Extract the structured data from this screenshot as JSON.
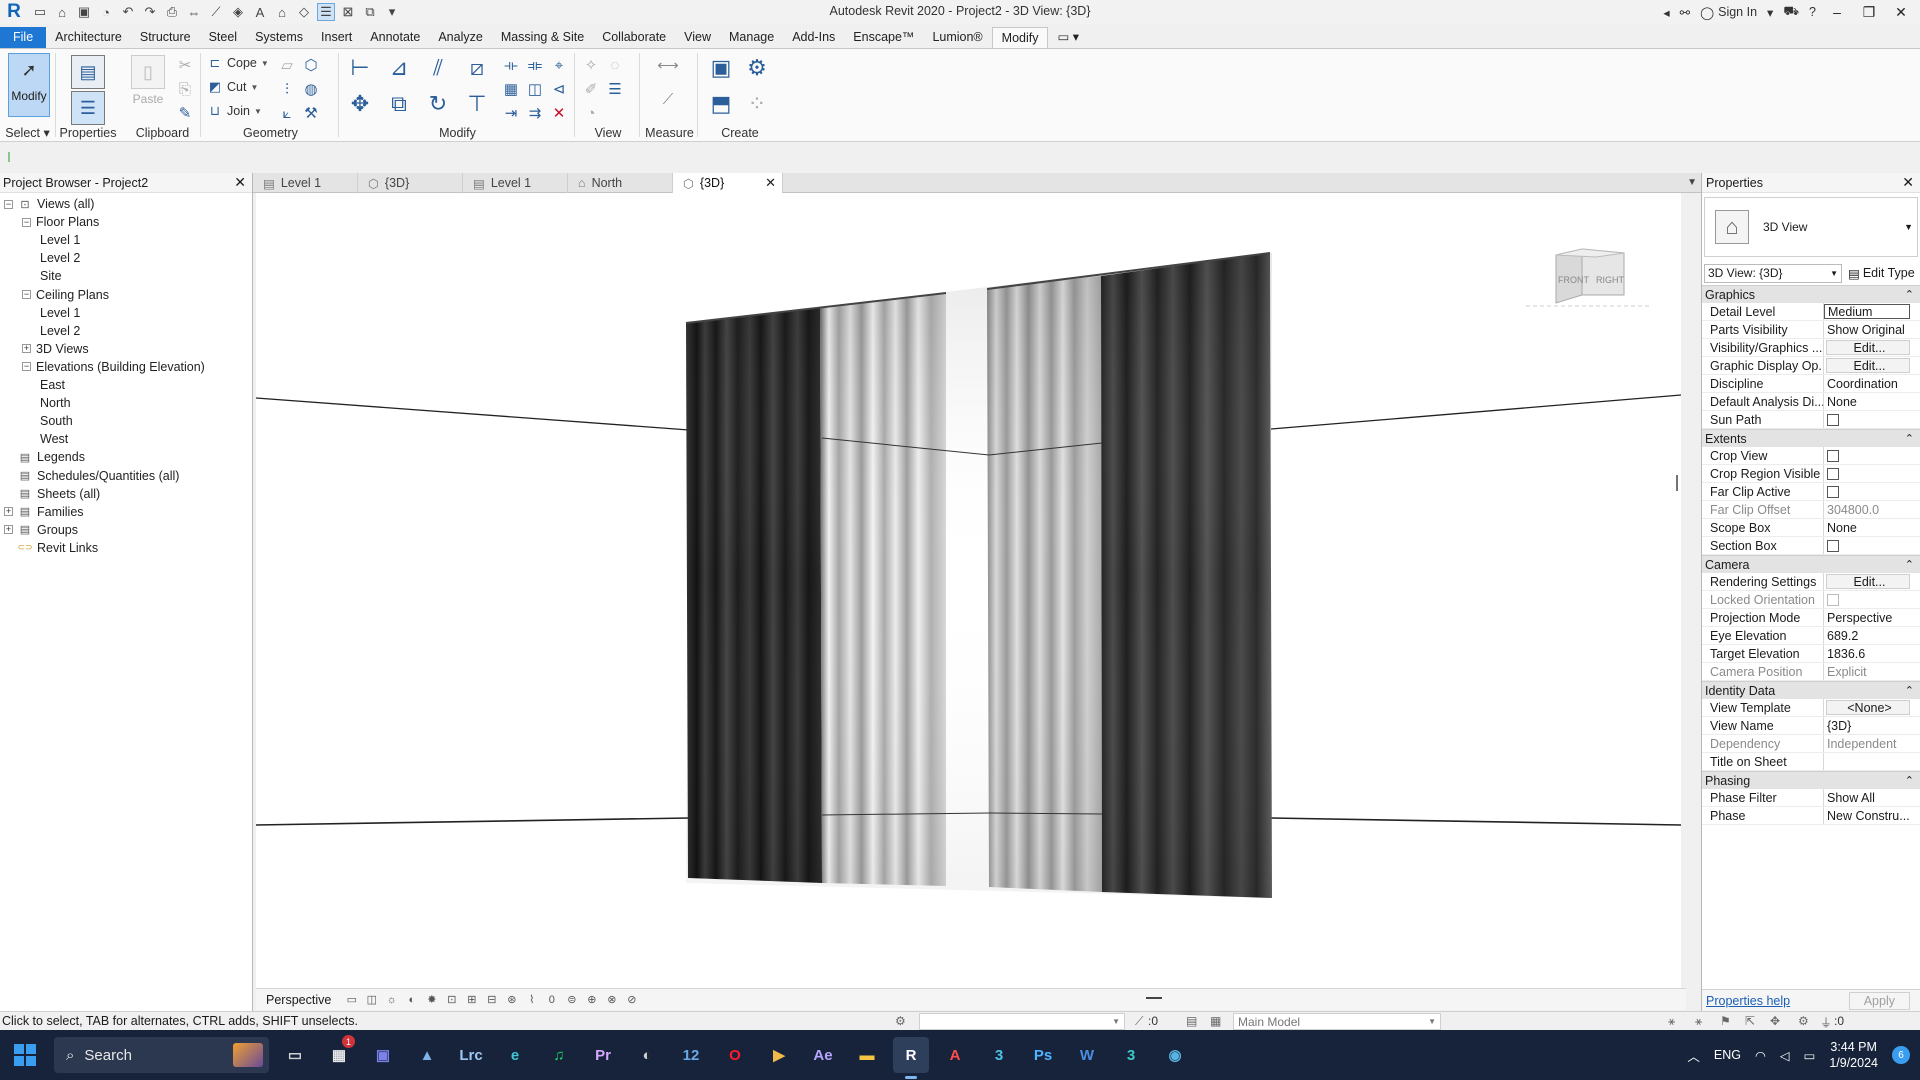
{
  "app": {
    "title": "Autodesk Revit 2020 - Project2 - 3D View: {3D}",
    "sign_in": "Sign In"
  },
  "ribbon": {
    "tabs": [
      "File",
      "Architecture",
      "Structure",
      "Steel",
      "Systems",
      "Insert",
      "Annotate",
      "Analyze",
      "Massing & Site",
      "Collaborate",
      "View",
      "Manage",
      "Add-Ins",
      "Enscape™",
      "Lumion®",
      "Modify"
    ],
    "active_tab": "Modify",
    "select_panel": {
      "modify_label": "Modify",
      "label": "Select"
    },
    "properties_button": "Properties",
    "clipboard": {
      "paste": "Paste",
      "label": "Clipboard"
    },
    "geometry": {
      "cope": "Cope",
      "cut": "Cut",
      "join": "Join",
      "label": "Geometry"
    },
    "modify_label": "Modify",
    "view_label": "View",
    "measure_label": "Measure",
    "create_label": "Create"
  },
  "project_browser": {
    "title": "Project Browser - Project2",
    "items": [
      {
        "label": "Views (all)",
        "level": 0,
        "toggle": "−",
        "icon": "views-icon"
      },
      {
        "label": "Floor Plans",
        "level": 1,
        "toggle": "−"
      },
      {
        "label": "Level 1",
        "level": 2
      },
      {
        "label": "Level 2",
        "level": 2
      },
      {
        "label": "Site",
        "level": 2
      },
      {
        "label": "Ceiling Plans",
        "level": 1,
        "toggle": "−"
      },
      {
        "label": "Level 1",
        "level": 2
      },
      {
        "label": "Level 2",
        "level": 2
      },
      {
        "label": "3D Views",
        "level": 1,
        "toggle": "+"
      },
      {
        "label": "Elevations (Building Elevation)",
        "level": 1,
        "toggle": "−"
      },
      {
        "label": "East",
        "level": 2
      },
      {
        "label": "North",
        "level": 2
      },
      {
        "label": "South",
        "level": 2
      },
      {
        "label": "West",
        "level": 2
      },
      {
        "label": "Legends",
        "level": 0,
        "icon": "legend-icon"
      },
      {
        "label": "Schedules/Quantities (all)",
        "level": 0,
        "icon": "schedule-icon"
      },
      {
        "label": "Sheets (all)",
        "level": 0,
        "icon": "sheet-icon"
      },
      {
        "label": "Families",
        "level": 0,
        "toggle": "+",
        "icon": "families-icon"
      },
      {
        "label": "Groups",
        "level": 0,
        "toggle": "+",
        "icon": "groups-icon"
      },
      {
        "label": "Revit Links",
        "level": 0,
        "icon": "link-icon"
      }
    ]
  },
  "view_tabs": [
    {
      "label": "Level 1",
      "icon": "floor-plan-icon"
    },
    {
      "label": "{3D}",
      "icon": "3d-view-icon"
    },
    {
      "label": "Level 1",
      "icon": "floor-plan-icon"
    },
    {
      "label": "North",
      "icon": "elevation-icon"
    },
    {
      "label": "{3D}",
      "icon": "3d-view-icon",
      "active": true
    }
  ],
  "view_cube": {
    "front": "FRONT",
    "right": "RIGHT"
  },
  "view_control": {
    "mode": "Perspective",
    "zero": "0"
  },
  "properties": {
    "title": "Properties",
    "type_name": "3D View",
    "instance_selector": "3D View: {3D}",
    "edit_type": "Edit Type",
    "groups": [
      {
        "name": "Graphics",
        "rows": [
          {
            "k": "Detail Level",
            "v": "Medium",
            "kind": "boxed"
          },
          {
            "k": "Parts Visibility",
            "v": "Show Original"
          },
          {
            "k": "Visibility/Graphics ...",
            "v": "Edit...",
            "kind": "btn"
          },
          {
            "k": "Graphic Display Op...",
            "v": "Edit...",
            "kind": "btn"
          },
          {
            "k": "Discipline",
            "v": "Coordination"
          },
          {
            "k": "Default Analysis Di...",
            "v": "None"
          },
          {
            "k": "Sun Path",
            "v": "",
            "kind": "check"
          }
        ]
      },
      {
        "name": "Extents",
        "rows": [
          {
            "k": "Crop View",
            "v": "",
            "kind": "check"
          },
          {
            "k": "Crop Region Visible",
            "v": "",
            "kind": "check"
          },
          {
            "k": "Far Clip Active",
            "v": "",
            "kind": "check"
          },
          {
            "k": "Far Clip Offset",
            "v": "304800.0",
            "kind": "dim"
          },
          {
            "k": "Scope Box",
            "v": "None"
          },
          {
            "k": "Section Box",
            "v": "",
            "kind": "check"
          }
        ]
      },
      {
        "name": "Camera",
        "rows": [
          {
            "k": "Rendering Settings",
            "v": "Edit...",
            "kind": "btn"
          },
          {
            "k": "Locked Orientation",
            "v": "",
            "kind": "dimcheck"
          },
          {
            "k": "Projection Mode",
            "v": "Perspective"
          },
          {
            "k": "Eye Elevation",
            "v": "689.2"
          },
          {
            "k": "Target Elevation",
            "v": "1836.6"
          },
          {
            "k": "Camera Position",
            "v": "Explicit",
            "kind": "dim"
          }
        ]
      },
      {
        "name": "Identity Data",
        "rows": [
          {
            "k": "View Template",
            "v": "<None>",
            "kind": "btn"
          },
          {
            "k": "View Name",
            "v": "{3D}"
          },
          {
            "k": "Dependency",
            "v": "Independent",
            "kind": "dim"
          },
          {
            "k": "Title on Sheet",
            "v": ""
          }
        ]
      },
      {
        "name": "Phasing",
        "rows": [
          {
            "k": "Phase Filter",
            "v": "Show All"
          },
          {
            "k": "Phase",
            "v": "New Constru..."
          }
        ]
      }
    ],
    "help_link": "Properties help",
    "apply": "Apply"
  },
  "status_bar": {
    "message": "Click to select, TAB for alternates, CTRL adds, SHIFT unselects.",
    "selection_count": ":0",
    "model": "Main Model",
    "filter_count": ":0"
  },
  "taskbar": {
    "search": "Search",
    "language": "ENG",
    "time": "3:44 PM",
    "date": "1/9/2024",
    "notifications": "6",
    "apps": [
      {
        "name": "task-view",
        "glyph": "▭",
        "color": "#d0d0d0"
      },
      {
        "name": "calendar-app",
        "glyph": "▦",
        "color": "#e8e8e8",
        "badge": "1"
      },
      {
        "name": "teams-app",
        "glyph": "▣",
        "color": "#7b83eb"
      },
      {
        "name": "photos-app",
        "glyph": "▲",
        "color": "#7fb3e8"
      },
      {
        "name": "lightroom-classic-app",
        "glyph": "Lrc",
        "color": "#9ec7f2"
      },
      {
        "name": "edge-app",
        "glyph": "e",
        "color": "#3ec6d6"
      },
      {
        "name": "spotify-app",
        "glyph": "♫",
        "color": "#1ed760"
      },
      {
        "name": "premiere-pro-app",
        "glyph": "Pr",
        "color": "#d7a6ff"
      },
      {
        "name": "disk-app",
        "glyph": "◐",
        "color": "#cfcfcf"
      },
      {
        "name": "calculator-app",
        "glyph": "12",
        "color": "#6aa9e6"
      },
      {
        "name": "opera-app",
        "glyph": "O",
        "color": "#ff1b2d"
      },
      {
        "name": "media-player-app",
        "glyph": "▶",
        "color": "#f2b84b"
      },
      {
        "name": "after-effects-app",
        "glyph": "Ae",
        "color": "#b6a6ff"
      },
      {
        "name": "file-explorer-app",
        "glyph": "▬",
        "color": "#f4c542"
      },
      {
        "name": "revit-app",
        "glyph": "R",
        "color": "#ffffff",
        "active": true
      },
      {
        "name": "autocad-app",
        "glyph": "A",
        "color": "#ff4d4d"
      },
      {
        "name": "3dsmax-app",
        "glyph": "3",
        "color": "#4cc2e6"
      },
      {
        "name": "photoshop-app",
        "glyph": "Ps",
        "color": "#4fb3ff"
      },
      {
        "name": "word-app",
        "glyph": "W",
        "color": "#4a8ee0"
      },
      {
        "name": "3dsmax-app-2",
        "glyph": "3",
        "color": "#3ec8c8"
      },
      {
        "name": "lumion-app",
        "glyph": "◉",
        "color": "#59b3e0"
      }
    ]
  }
}
